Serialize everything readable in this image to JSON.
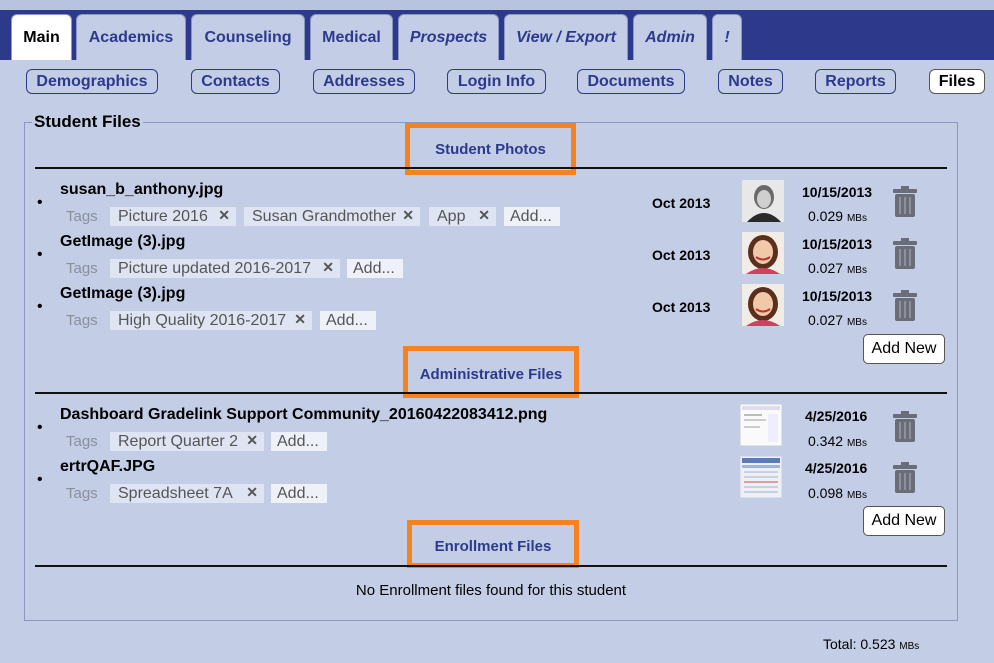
{
  "tabs": [
    {
      "label": "Main",
      "active": true,
      "italic": false
    },
    {
      "label": "Academics",
      "active": false,
      "italic": false
    },
    {
      "label": "Counseling",
      "active": false,
      "italic": false
    },
    {
      "label": "Medical",
      "active": false,
      "italic": false
    },
    {
      "label": "Prospects",
      "active": false,
      "italic": true
    },
    {
      "label": "View / Export",
      "active": false,
      "italic": true
    },
    {
      "label": "Admin",
      "active": false,
      "italic": true
    },
    {
      "label": "!",
      "active": false,
      "italic": true
    }
  ],
  "subtabs": [
    {
      "label": "Demographics",
      "active": false
    },
    {
      "label": "Contacts",
      "active": false
    },
    {
      "label": "Addresses",
      "active": false
    },
    {
      "label": "Login Info",
      "active": false
    },
    {
      "label": "Documents",
      "active": false
    },
    {
      "label": "Notes",
      "active": false
    },
    {
      "label": "Reports",
      "active": false
    },
    {
      "label": "Files",
      "active": true
    }
  ],
  "panel_title": "Student Files",
  "tags_label": "Tags",
  "add_tag_label": "Add...",
  "add_new_label": "Add New",
  "size_unit": "MBs",
  "sections": {
    "photos": {
      "heading": "Student Photos",
      "files": [
        {
          "name": "susan_b_anthony.jpg",
          "month": "Oct 2013",
          "date": "10/15/2013",
          "size": "0.029",
          "tags": [
            "Picture 2016",
            "Susan Grandmother",
            "App"
          ],
          "thumb": "bw-portrait"
        },
        {
          "name": "GetImage (3).jpg",
          "month": "Oct 2013",
          "date": "10/15/2013",
          "size": "0.027",
          "tags": [
            "Picture updated 2016-2017"
          ],
          "thumb": "girl-portrait"
        },
        {
          "name": "GetImage (3).jpg",
          "month": "Oct 2013",
          "date": "10/15/2013",
          "size": "0.027",
          "tags": [
            "High Quality 2016-2017"
          ],
          "thumb": "girl-portrait"
        }
      ]
    },
    "admin": {
      "heading": "Administrative Files",
      "files": [
        {
          "name": "Dashboard Gradelink Support Community_20160422083412.png",
          "date": "4/25/2016",
          "size": "0.342",
          "tags": [
            "Report Quarter 2"
          ],
          "thumb": "screenshot-light"
        },
        {
          "name": "ertrQAF.JPG",
          "date": "4/25/2016",
          "size": "0.098",
          "tags": [
            "Spreadsheet 7A"
          ],
          "thumb": "spreadsheet"
        }
      ]
    },
    "enrollment": {
      "heading": "Enrollment Files",
      "empty_message": "No Enrollment files found for this student"
    }
  },
  "total_label": "Total:",
  "total_value": "0.523",
  "colors": {
    "accent": "#2d3a8c",
    "highlight": "#f58220",
    "background": "#c3cde6"
  },
  "icons": {
    "delete": "trash-icon"
  }
}
